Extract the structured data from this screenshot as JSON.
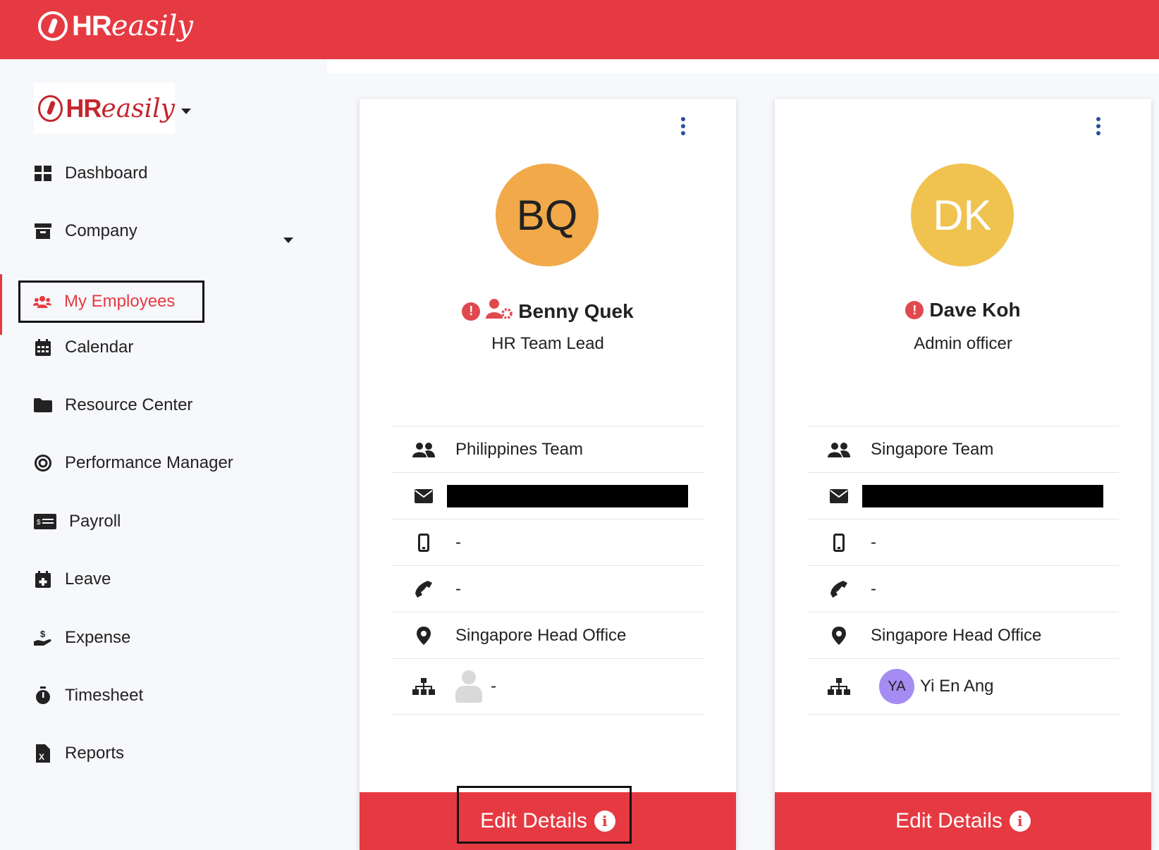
{
  "header": {
    "brand_hr": "HR",
    "brand_easily": "easily"
  },
  "org": {
    "logo_hr": "HR",
    "logo_easily": "easily"
  },
  "sidebar": {
    "items": [
      {
        "label": "Dashboard",
        "icon": "dashboard-icon"
      },
      {
        "label": "Company",
        "icon": "archive-icon"
      },
      {
        "label": "My Employees",
        "icon": "users-icon"
      },
      {
        "label": "Calendar",
        "icon": "calendar-icon"
      },
      {
        "label": "Resource Center",
        "icon": "folder-icon"
      },
      {
        "label": "Performance Manager",
        "icon": "target-icon"
      },
      {
        "label": "Payroll",
        "icon": "money-check-icon"
      },
      {
        "label": "Leave",
        "icon": "calendar-plus-icon"
      },
      {
        "label": "Expense",
        "icon": "hand-dollar-icon"
      },
      {
        "label": "Timesheet",
        "icon": "stopwatch-icon"
      },
      {
        "label": "Reports",
        "icon": "file-excel-icon"
      }
    ]
  },
  "employees": [
    {
      "initials": "BQ",
      "avatar_color": "#f1a94a",
      "name": "Benny Quek",
      "role": "HR Team Lead",
      "team": "Philippines Team",
      "mobile": "-",
      "phone": "-",
      "location": "Singapore Head Office",
      "manager": "-",
      "edit_label": "Edit Details"
    },
    {
      "initials": "DK",
      "avatar_color": "#f0c24f",
      "name": "Dave Koh",
      "role": "Admin officer",
      "team": "Singapore Team",
      "mobile": "-",
      "phone": "-",
      "location": "Singapore Head Office",
      "manager_initials": "YA",
      "manager": "Yi En Ang",
      "edit_label": "Edit Details"
    }
  ],
  "colors": {
    "brand_red": "#e63a42",
    "kebab_blue": "#2a4fa0",
    "manager_avatar": "#a48cf2"
  }
}
